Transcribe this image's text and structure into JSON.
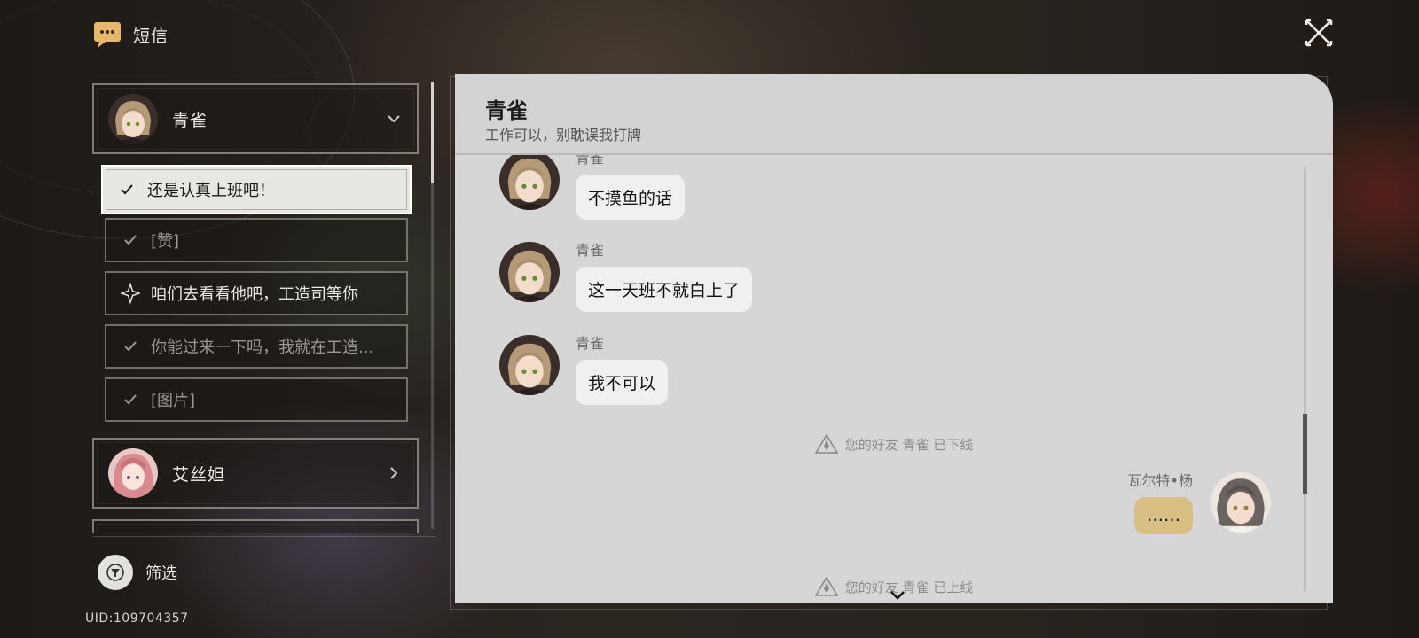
{
  "header": {
    "title": "短信",
    "icon": "message-icon"
  },
  "contacts": [
    {
      "name": "青雀",
      "expanded": true,
      "threads": [
        {
          "text": "还是认真上班吧！",
          "status": "selected"
        },
        {
          "text": "[赞]",
          "status": "read"
        },
        {
          "text": "咱们去看看他吧，工造司等你",
          "status": "mission"
        },
        {
          "text": "你能过来一下吗，我就在工造...",
          "status": "read"
        },
        {
          "text": "[图片]",
          "status": "read"
        }
      ]
    },
    {
      "name": "艾丝妲",
      "expanded": false,
      "threads": []
    }
  ],
  "filter": {
    "label": "筛选"
  },
  "uid": "UID:109704357",
  "chat": {
    "title": "青雀",
    "subtitle": "工作可以，别耽误我打牌",
    "messages": [
      {
        "sender": "青雀",
        "text": "不摸鱼的话",
        "self": false
      },
      {
        "sender": "青雀",
        "text": "这一天班不就白上了",
        "self": false
      },
      {
        "sender": "青雀",
        "text": "我不可以",
        "self": false
      },
      {
        "system": "您的好友 青雀 已下线"
      },
      {
        "sender": "瓦尔特•杨",
        "text": "……",
        "self": true
      },
      {
        "system": "您的好友 青雀 已上线"
      }
    ]
  },
  "colors": {
    "accent": "#d8bf84",
    "panel": "#d6d6d6",
    "selected": "#e9e7e4"
  }
}
